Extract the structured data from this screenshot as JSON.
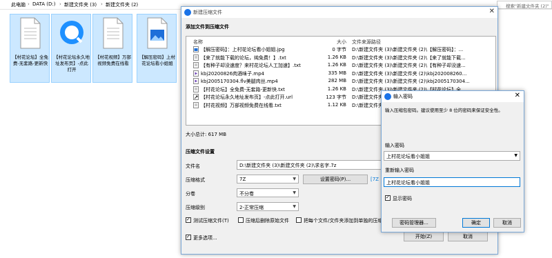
{
  "address_bar": {
    "crumbs": [
      "此电脑",
      "DATA (D:)",
      "新建文件夹 (3)",
      "新建文件夹 (2)"
    ],
    "search_placeholder": "搜索\"新建文件夹 (2)\""
  },
  "explorer_files": [
    {
      "name": "【村花论坛】全免费-无套路-更新快",
      "icon": "document-icon"
    },
    {
      "name": "【村花论坛永久地址发布页】-点此打开",
      "icon": "browser-shortcut-icon"
    },
    {
      "name": "【村花视频】万部视频免费在线看",
      "icon": "document-icon"
    },
    {
      "name": "【解压密码】上村花论坛看小姐姐",
      "icon": "image-file-icon"
    }
  ],
  "archive_dialog": {
    "title": "新建压缩文件",
    "section_add": "添加文件到压缩文件",
    "columns": {
      "name": "名称",
      "size": "大小",
      "path": "文件来源路径"
    },
    "files": [
      {
        "name": "【解压密码】：上村花论坛看小姐姐.jpg",
        "size": "0 字节",
        "path": "D:\\新建文件夹 (3)\\新建文件夹 (2)\\【解压密码】：...",
        "icon": "image-icon"
      },
      {
        "name": "【来了就能下载的论坛，纯免费！】.txt",
        "size": "1.26 KB",
        "path": "D:\\新建文件夹 (3)\\新建文件夹 (2)\\【来了就能下载...",
        "icon": "text-file-icon"
      },
      {
        "name": "【有种子却没速度？来村花论坛人工加速】.txt",
        "size": "1.26 KB",
        "path": "D:\\新建文件夹 (3)\\新建文件夹 (2)\\【有种子却没速...",
        "icon": "text-file-icon"
      },
      {
        "name": "kbj20200826肉酒味子.mp4",
        "size": "335 MB",
        "path": "D:\\新建文件夹 (3)\\新建文件夹 (2)\\kbj202008260...",
        "icon": "video-icon"
      },
      {
        "name": "kbj2005170304.flv美腿肉丝.mp4",
        "size": "282 MB",
        "path": "D:\\新建文件夹 (3)\\新建文件夹 (2)\\kbj2005170304...",
        "icon": "video-icon"
      },
      {
        "name": "【村花论坛】全免费-无套路-更新快.txt",
        "size": "1.26 KB",
        "path": "D:\\新建文件夹 (3)\\新建文件夹 (2)\\【村花论坛】全...",
        "icon": "text-file-icon"
      },
      {
        "name": "【村花论坛永久地址发布页】-点此打开.url",
        "size": "123 字节",
        "path": "D:\\新建文件夹 (3)\\新建文件夹 (2)\\【村花论坛永久...",
        "icon": "url-icon"
      },
      {
        "name": "【村花视频】万部视频免费在线看.txt",
        "size": "1.12 KB",
        "path": "D:\\新建文件夹 (3)\\新建文件夹 (2)\\【村花视频】万...",
        "icon": "text-file-icon"
      }
    ],
    "total_size": "大小总计: 617 MB",
    "section_settings": "压缩文件设置",
    "filename_label": "文件名",
    "filename_value": "D:\\新建文件夹 (3)\\新建文件夹 (2)\\求名字.7z",
    "format_label": "压缩格式",
    "format_value": "7Z",
    "set_password_button": "设置密码(P)...",
    "format_hint": "[7Z",
    "split_label": "分卷",
    "split_value": "不分卷",
    "level_label": "压缩级别",
    "level_value": "2-正常压缩",
    "test_checkbox": "测试压缩文件(T)",
    "delete_checkbox": "压缩后删除原始文件",
    "each_checkbox": "把每个文件/文件夹添加到单独的压缩",
    "more_options": "更多选项...",
    "start_button": "开始(Z)",
    "cancel_button": "取消"
  },
  "password_dialog": {
    "title": "输入密码",
    "hint": "输入压缩包密码。建议使用至少 8 位的密码来保证安全性。",
    "password_label": "输入密码",
    "password_value": "上村花论坛看小姐姐",
    "confirm_label": "重新输入密码",
    "confirm_value": "上村花论坛看小姐姐",
    "show_password": "显示密码",
    "manager_button": "密码管理器...",
    "ok_button": "确定",
    "cancel_button": "取消"
  },
  "colors": {
    "accent": "#0078d7",
    "selection": "#cce8ff"
  }
}
